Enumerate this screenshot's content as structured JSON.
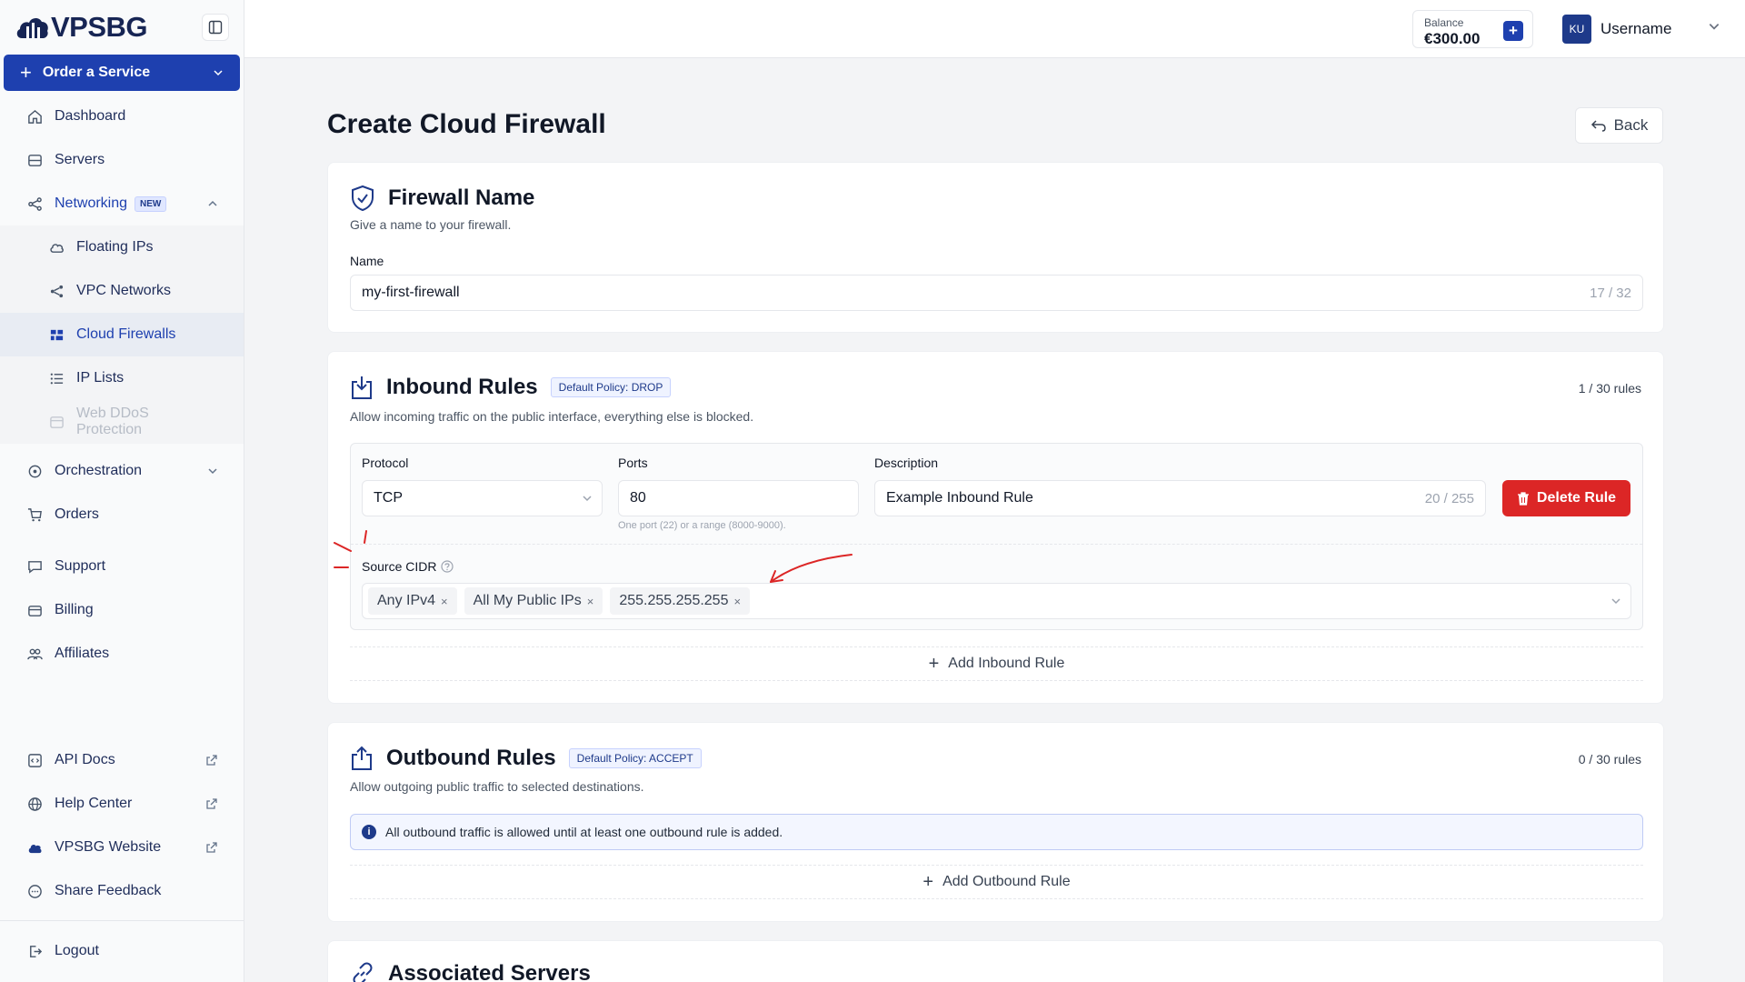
{
  "brand": {
    "name": "VPSBG"
  },
  "sidebar": {
    "order_button": "Order a Service",
    "items": [
      {
        "label": "Dashboard",
        "icon": "home-icon"
      },
      {
        "label": "Servers",
        "icon": "server-icon"
      },
      {
        "label": "Networking",
        "icon": "share-icon",
        "badge": "NEW"
      },
      {
        "label": "Orchestration",
        "icon": "orchestration-icon"
      },
      {
        "label": "Orders",
        "icon": "cart-icon"
      },
      {
        "label": "Support",
        "icon": "chat-icon"
      },
      {
        "label": "Billing",
        "icon": "wallet-icon"
      },
      {
        "label": "Affiliates",
        "icon": "users-icon"
      }
    ],
    "networking_sub": [
      {
        "label": "Floating IPs",
        "icon": "cloud-icon"
      },
      {
        "label": "VPC Networks",
        "icon": "share-icon"
      },
      {
        "label": "Cloud Firewalls",
        "icon": "firewall-icon"
      },
      {
        "label": "IP Lists",
        "icon": "list-icon"
      },
      {
        "label": "Web DDoS Protection",
        "icon": "window-icon"
      }
    ],
    "footer": [
      {
        "label": "API Docs",
        "icon": "code-icon"
      },
      {
        "label": "Help Center",
        "icon": "globe-icon"
      },
      {
        "label": "VPSBG Website",
        "icon": "cloud-icon"
      },
      {
        "label": "Share Feedback",
        "icon": "chat-icon"
      }
    ],
    "logout": "Logout"
  },
  "topbar": {
    "balance_label": "Balance",
    "balance_value": "€300.00",
    "avatar_initials": "KU",
    "username": "Username"
  },
  "page": {
    "title": "Create Cloud Firewall",
    "back": "Back"
  },
  "firewall_name": {
    "title": "Firewall Name",
    "subtitle": "Give a name to your firewall.",
    "label": "Name",
    "value": "my-first-firewall",
    "counter": "17 / 32"
  },
  "inbound": {
    "title": "Inbound Rules",
    "policy": "Default Policy: DROP",
    "subtitle": "Allow incoming traffic on the public interface, everything else is blocked.",
    "count": "1 / 30 rules",
    "protocol_label": "Protocol",
    "protocol_value": "TCP",
    "ports_label": "Ports",
    "ports_value": "80",
    "ports_hint": "One port (22) or a range (8000-9000).",
    "desc_label": "Description",
    "desc_value": "Example Inbound Rule",
    "desc_counter": "20 / 255",
    "delete": "Delete Rule",
    "cidr_label": "Source CIDR",
    "cidrs": [
      "Any IPv4",
      "All My Public IPs",
      "255.255.255.255"
    ],
    "add": "Add Inbound Rule"
  },
  "outbound": {
    "title": "Outbound Rules",
    "policy": "Default Policy: ACCEPT",
    "subtitle": "Allow outgoing public traffic to selected destinations.",
    "count": "0 / 30 rules",
    "info": "All outbound traffic is allowed until at least one outbound rule is added.",
    "add": "Add Outbound Rule"
  },
  "associated": {
    "title": "Associated Servers"
  },
  "colors": {
    "primary": "#1e40af",
    "danger": "#dc2626",
    "annotation": "#dc2626"
  }
}
